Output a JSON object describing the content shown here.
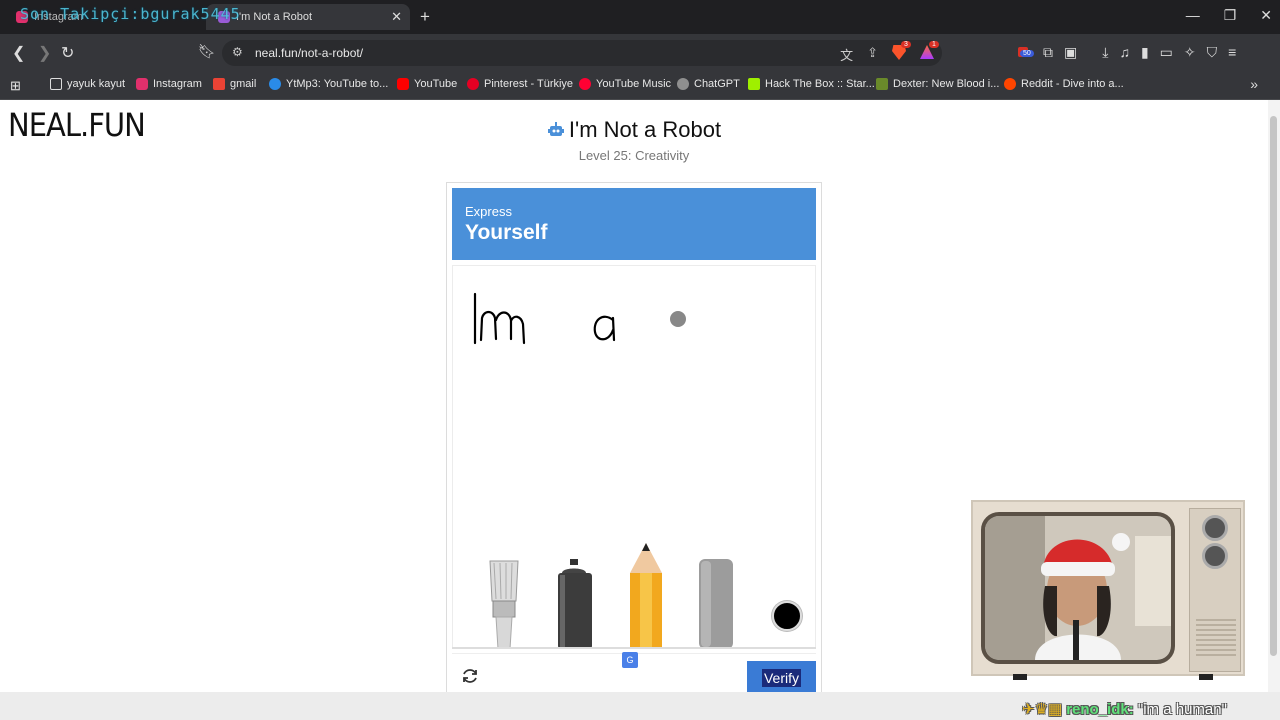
{
  "browser": {
    "tabs": [
      {
        "title": "Instagram",
        "favicon_color": "#e1306c"
      },
      {
        "title": "I'm Not a Robot",
        "favicon_color": "#9a5bd6"
      }
    ],
    "overlay_text": "Son Takipçi:bgurak5445",
    "url": "neal.fun/not-a-robot/",
    "extension_badge_1": "3",
    "extension_badge_2": "1",
    "extension_badge_3": "50",
    "bookmarks": [
      {
        "label": "yayuk kayut",
        "color": "#cfa550"
      },
      {
        "label": "Instagram",
        "color": "#e1306c"
      },
      {
        "label": "gmail",
        "color": "#ea4335"
      },
      {
        "label": "YtMp3: YouTube to...",
        "color": "#2a8be8"
      },
      {
        "label": "YouTube",
        "color": "#ff0000"
      },
      {
        "label": "Pinterest - Türkiye",
        "color": "#e60023"
      },
      {
        "label": "YouTube Music",
        "color": "#ff0033"
      },
      {
        "label": "ChatGPT",
        "color": "#8f8f8f"
      },
      {
        "label": "Hack The Box :: Star...",
        "color": "#9fef00"
      },
      {
        "label": "Dexter: New Blood i...",
        "color": "#6a8a2a"
      },
      {
        "label": "Reddit - Dive into a...",
        "color": "#ff4500"
      }
    ]
  },
  "page": {
    "logo": "NEAL.FUN",
    "title": "I'm Not a Robot",
    "subtitle": "Level 25: Creativity"
  },
  "captcha": {
    "header_small": "Express",
    "header_big": "Yourself",
    "verify_label": "Verify",
    "tools": [
      "paintbrush",
      "spray-can",
      "pencil",
      "eraser",
      "color-picker"
    ],
    "selected_color": "#000000",
    "cursor_color": "#888888"
  },
  "stream_overlay": {
    "chat_user": "reno_idk:",
    "chat_message": "\"im a human\""
  }
}
